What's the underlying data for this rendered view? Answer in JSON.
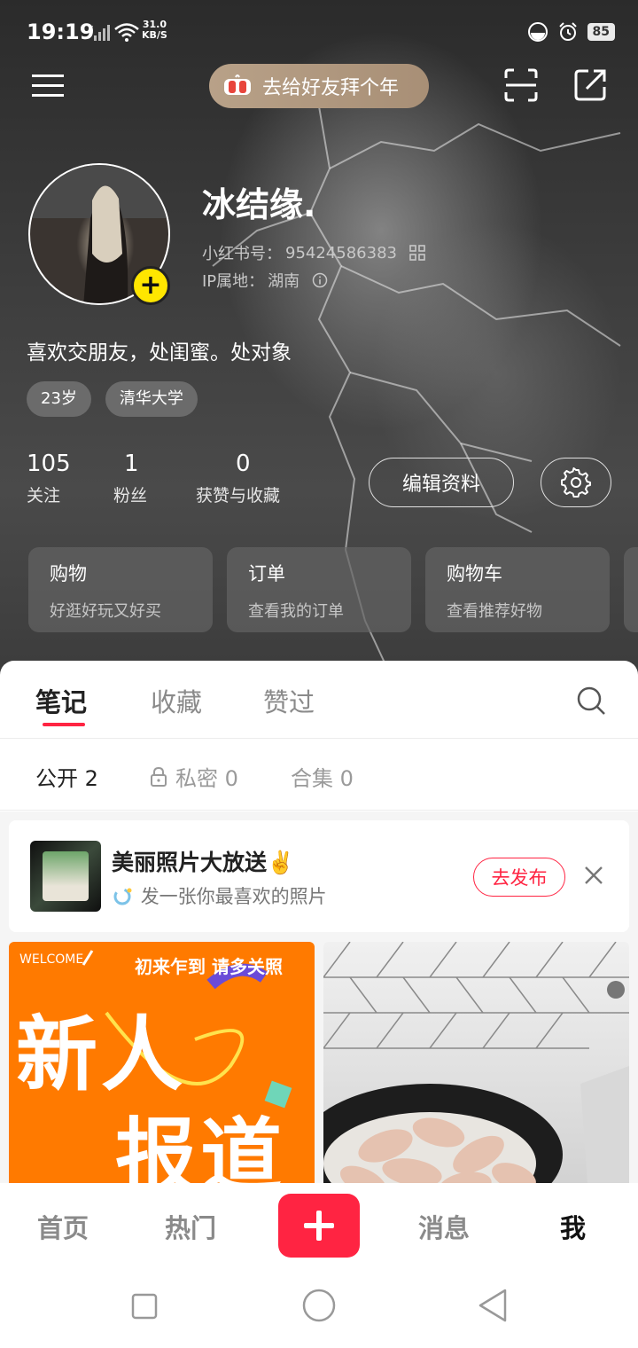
{
  "status_bar": {
    "time": "19:19",
    "net_speed_value": "31.0",
    "net_speed_unit": "KB/S",
    "battery": "85"
  },
  "header": {
    "new_year_pill": "去给好友拜个年"
  },
  "profile": {
    "nickname": "冰结缘.",
    "id_label": "小红书号：",
    "id_value": "95424586383",
    "ip_label": "IP属地：",
    "ip_value": "湖南",
    "bio": "喜欢交朋友，处闺蜜。处对象",
    "tags": [
      "23岁",
      "清华大学"
    ]
  },
  "stats": [
    {
      "num": "105",
      "label": "关注"
    },
    {
      "num": "1",
      "label": "粉丝"
    },
    {
      "num": "0",
      "label": "获赞与收藏"
    }
  ],
  "actions": {
    "edit_label": "编辑资料"
  },
  "shortcut_cards": [
    {
      "title": "购物",
      "subtitle": "好逛好玩又好买"
    },
    {
      "title": "订单",
      "subtitle": "查看我的订单"
    },
    {
      "title": "购物车",
      "subtitle": "查看推荐好物"
    }
  ],
  "content_tabs": [
    "笔记",
    "收藏",
    "赞过"
  ],
  "sub_tabs": [
    "公开 2",
    "私密 0",
    "合集 0"
  ],
  "promo": {
    "title": "美丽照片大放送✌️",
    "subtitle": "发一张你最喜欢的照片",
    "publish_label": "去发布"
  },
  "notes": [
    {
      "welcome": "WELCOME",
      "headline": "初来乍到 请多关照",
      "big_text_line1": "新人",
      "big_text_line2": "报道"
    }
  ],
  "bottom_nav": {
    "items": [
      "首页",
      "热门",
      "消息",
      "我"
    ],
    "active": "我"
  },
  "colors": {
    "accent_red": "#ff2442",
    "avatar_badge_yellow": "#ffe600",
    "note_orange": "#ff7a00"
  }
}
